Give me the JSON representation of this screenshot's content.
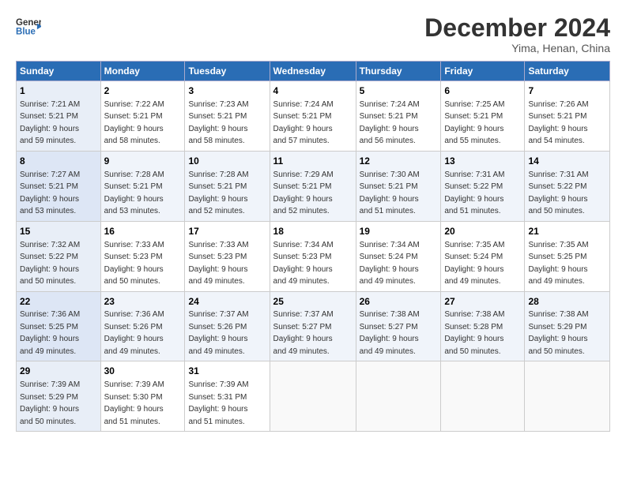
{
  "logo": {
    "line1": "General",
    "line2": "Blue",
    "arrow_symbol": "▶"
  },
  "title": "December 2024",
  "location": "Yima, Henan, China",
  "days_header": [
    "Sunday",
    "Monday",
    "Tuesday",
    "Wednesday",
    "Thursday",
    "Friday",
    "Saturday"
  ],
  "weeks": [
    [
      {
        "day": "1",
        "info": "Sunrise: 7:21 AM\nSunset: 5:21 PM\nDaylight: 9 hours\nand 59 minutes."
      },
      {
        "day": "2",
        "info": "Sunrise: 7:22 AM\nSunset: 5:21 PM\nDaylight: 9 hours\nand 58 minutes."
      },
      {
        "day": "3",
        "info": "Sunrise: 7:23 AM\nSunset: 5:21 PM\nDaylight: 9 hours\nand 58 minutes."
      },
      {
        "day": "4",
        "info": "Sunrise: 7:24 AM\nSunset: 5:21 PM\nDaylight: 9 hours\nand 57 minutes."
      },
      {
        "day": "5",
        "info": "Sunrise: 7:24 AM\nSunset: 5:21 PM\nDaylight: 9 hours\nand 56 minutes."
      },
      {
        "day": "6",
        "info": "Sunrise: 7:25 AM\nSunset: 5:21 PM\nDaylight: 9 hours\nand 55 minutes."
      },
      {
        "day": "7",
        "info": "Sunrise: 7:26 AM\nSunset: 5:21 PM\nDaylight: 9 hours\nand 54 minutes."
      }
    ],
    [
      {
        "day": "8",
        "info": "Sunrise: 7:27 AM\nSunset: 5:21 PM\nDaylight: 9 hours\nand 53 minutes."
      },
      {
        "day": "9",
        "info": "Sunrise: 7:28 AM\nSunset: 5:21 PM\nDaylight: 9 hours\nand 53 minutes."
      },
      {
        "day": "10",
        "info": "Sunrise: 7:28 AM\nSunset: 5:21 PM\nDaylight: 9 hours\nand 52 minutes."
      },
      {
        "day": "11",
        "info": "Sunrise: 7:29 AM\nSunset: 5:21 PM\nDaylight: 9 hours\nand 52 minutes."
      },
      {
        "day": "12",
        "info": "Sunrise: 7:30 AM\nSunset: 5:21 PM\nDaylight: 9 hours\nand 51 minutes."
      },
      {
        "day": "13",
        "info": "Sunrise: 7:31 AM\nSunset: 5:22 PM\nDaylight: 9 hours\nand 51 minutes."
      },
      {
        "day": "14",
        "info": "Sunrise: 7:31 AM\nSunset: 5:22 PM\nDaylight: 9 hours\nand 50 minutes."
      }
    ],
    [
      {
        "day": "15",
        "info": "Sunrise: 7:32 AM\nSunset: 5:22 PM\nDaylight: 9 hours\nand 50 minutes."
      },
      {
        "day": "16",
        "info": "Sunrise: 7:33 AM\nSunset: 5:23 PM\nDaylight: 9 hours\nand 50 minutes."
      },
      {
        "day": "17",
        "info": "Sunrise: 7:33 AM\nSunset: 5:23 PM\nDaylight: 9 hours\nand 49 minutes."
      },
      {
        "day": "18",
        "info": "Sunrise: 7:34 AM\nSunset: 5:23 PM\nDaylight: 9 hours\nand 49 minutes."
      },
      {
        "day": "19",
        "info": "Sunrise: 7:34 AM\nSunset: 5:24 PM\nDaylight: 9 hours\nand 49 minutes."
      },
      {
        "day": "20",
        "info": "Sunrise: 7:35 AM\nSunset: 5:24 PM\nDaylight: 9 hours\nand 49 minutes."
      },
      {
        "day": "21",
        "info": "Sunrise: 7:35 AM\nSunset: 5:25 PM\nDaylight: 9 hours\nand 49 minutes."
      }
    ],
    [
      {
        "day": "22",
        "info": "Sunrise: 7:36 AM\nSunset: 5:25 PM\nDaylight: 9 hours\nand 49 minutes."
      },
      {
        "day": "23",
        "info": "Sunrise: 7:36 AM\nSunset: 5:26 PM\nDaylight: 9 hours\nand 49 minutes."
      },
      {
        "day": "24",
        "info": "Sunrise: 7:37 AM\nSunset: 5:26 PM\nDaylight: 9 hours\nand 49 minutes."
      },
      {
        "day": "25",
        "info": "Sunrise: 7:37 AM\nSunset: 5:27 PM\nDaylight: 9 hours\nand 49 minutes."
      },
      {
        "day": "26",
        "info": "Sunrise: 7:38 AM\nSunset: 5:27 PM\nDaylight: 9 hours\nand 49 minutes."
      },
      {
        "day": "27",
        "info": "Sunrise: 7:38 AM\nSunset: 5:28 PM\nDaylight: 9 hours\nand 50 minutes."
      },
      {
        "day": "28",
        "info": "Sunrise: 7:38 AM\nSunset: 5:29 PM\nDaylight: 9 hours\nand 50 minutes."
      }
    ],
    [
      {
        "day": "29",
        "info": "Sunrise: 7:39 AM\nSunset: 5:29 PM\nDaylight: 9 hours\nand 50 minutes."
      },
      {
        "day": "30",
        "info": "Sunrise: 7:39 AM\nSunset: 5:30 PM\nDaylight: 9 hours\nand 51 minutes."
      },
      {
        "day": "31",
        "info": "Sunrise: 7:39 AM\nSunset: 5:31 PM\nDaylight: 9 hours\nand 51 minutes."
      },
      {
        "day": "",
        "info": ""
      },
      {
        "day": "",
        "info": ""
      },
      {
        "day": "",
        "info": ""
      },
      {
        "day": "",
        "info": ""
      }
    ]
  ]
}
